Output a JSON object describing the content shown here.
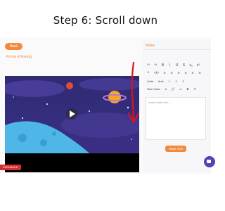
{
  "instruction": {
    "text": "Step 6: Scroll down"
  },
  "left": {
    "back_label": "Back",
    "section_title": "Forms of Energy"
  },
  "video": {
    "play_icon": "play-icon"
  },
  "feedback": {
    "label": "FEEDBACK"
  },
  "notes": {
    "title": "Notes",
    "toolbar_row1": [
      "↶",
      "↷",
      "B",
      "I",
      "U",
      "S",
      "x₂",
      "x²"
    ],
    "toolbar_row2": [
      "❝",
      "</>",
      "≡",
      "≡",
      "≡",
      "≡",
      "≡",
      "≡"
    ],
    "toolbar_row3": [
      "Arbitr",
      "Arial",
      "1",
      "2",
      "3"
    ],
    "toolbar_row4": [
      "Size Class",
      "A",
      "🔗",
      "▭",
      "✖",
      "⟲"
    ],
    "placeholder": "Notes start here...",
    "save_label": "Save Text"
  },
  "colors": {
    "accent": "#f08a3c",
    "annotation_arrow": "#e0101a",
    "chat": "#5b3fb5"
  }
}
